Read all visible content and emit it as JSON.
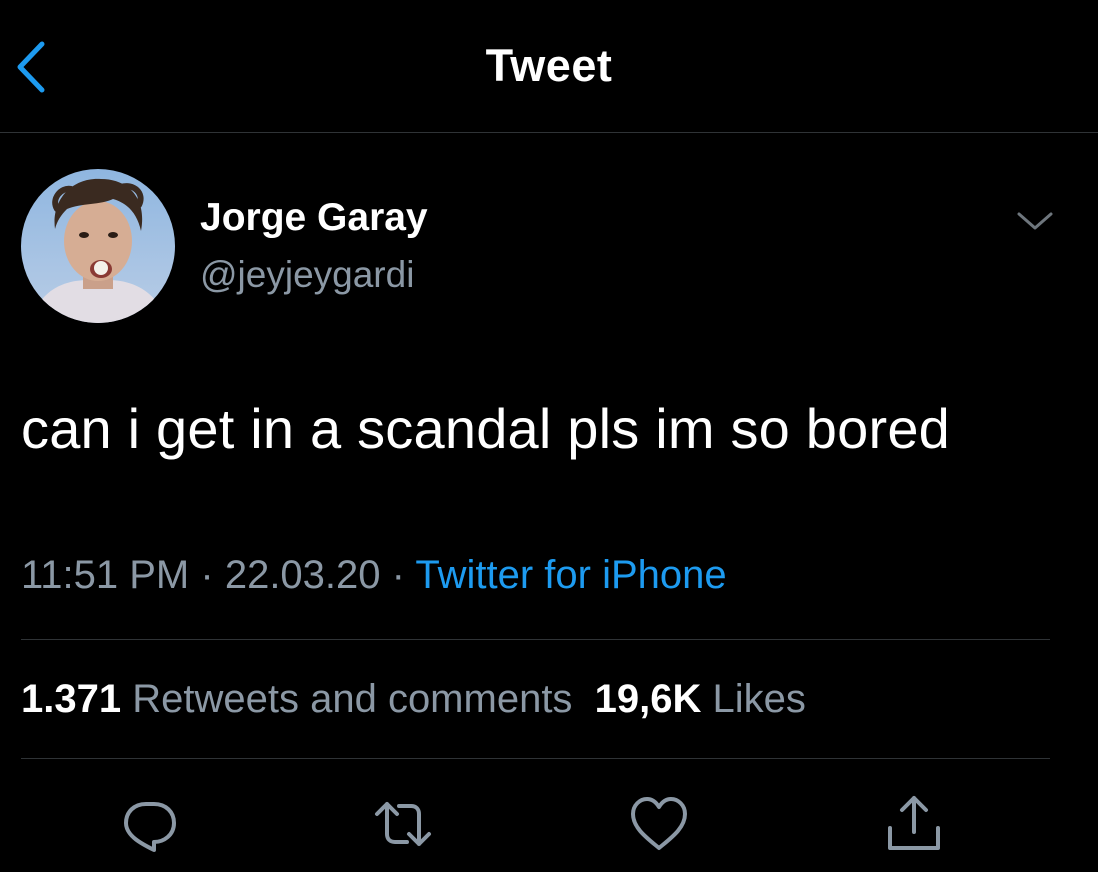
{
  "nav": {
    "title": "Tweet",
    "back_icon": "chevron-left-icon",
    "accent": "#1d9bf0"
  },
  "author": {
    "name": "Jorge Garay",
    "handle": "@jeyjeygardi",
    "avatar": "profile-photo"
  },
  "tweet": {
    "text": "can i get in a scandal pls im so bored",
    "time": "11:51 PM",
    "separator": "·",
    "date": "22.03.20",
    "source": "Twitter for iPhone"
  },
  "stats": {
    "retweets_count": "1.371",
    "retweets_label": "Retweets and comments",
    "likes_count": "19,6K",
    "likes_label": "Likes"
  },
  "actions": [
    {
      "icon": "reply-icon"
    },
    {
      "icon": "retweet-icon"
    },
    {
      "icon": "heart-icon"
    },
    {
      "icon": "share-icon"
    }
  ],
  "colors": {
    "background": "#000000",
    "text": "#ffffff",
    "secondary": "#8b98a5",
    "link": "#1d9bf0",
    "divider": "#2f3336"
  }
}
